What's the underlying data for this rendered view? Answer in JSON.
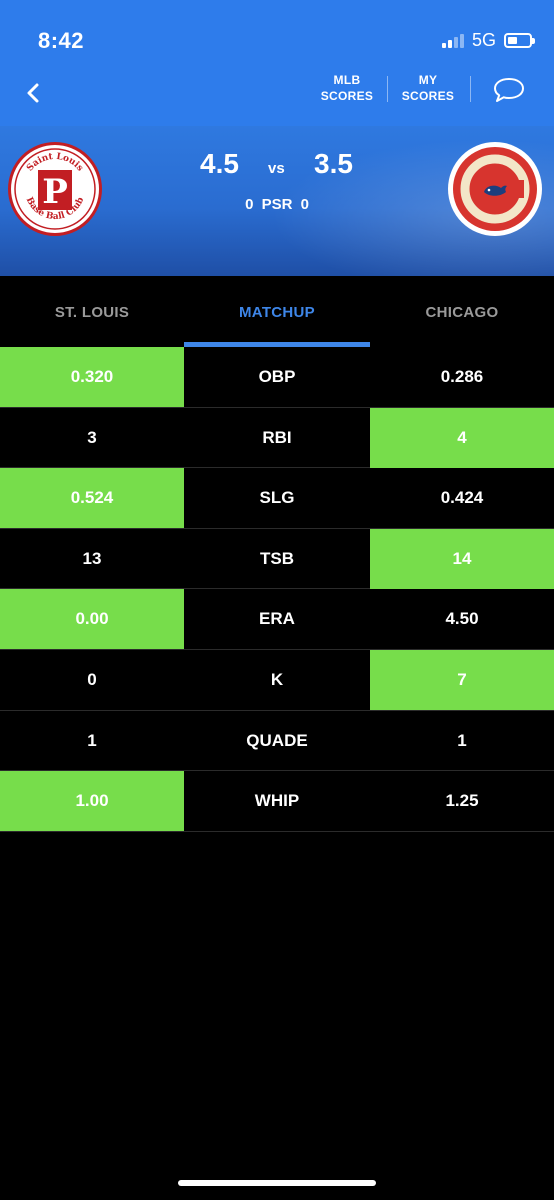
{
  "status_bar": {
    "time": "8:42",
    "network": "5G"
  },
  "header": {
    "mlb_scores": "MLB\nSCORES",
    "my_scores": "MY\nSCORES"
  },
  "game": {
    "away_team": "ST. LOUIS",
    "home_team": "CHICAGO",
    "away_score": "4.5",
    "home_score": "3.5",
    "vs_label": "vs",
    "psr_text": "0 PSR 0",
    "away_logo_text": "P",
    "away_logo_ring_text": "Saint Louis Base Ball Club",
    "home_logo_text": "C"
  },
  "tabs": [
    {
      "label": "ST. LOUIS",
      "active": false
    },
    {
      "label": "MATCHUP",
      "active": true
    },
    {
      "label": "CHICAGO",
      "active": false
    }
  ],
  "stats": [
    {
      "stat": "OBP",
      "away": "0.320",
      "home": "0.286",
      "winner": "away"
    },
    {
      "stat": "RBI",
      "away": "3",
      "home": "4",
      "winner": "home"
    },
    {
      "stat": "SLG",
      "away": "0.524",
      "home": "0.424",
      "winner": "away"
    },
    {
      "stat": "TSB",
      "away": "13",
      "home": "14",
      "winner": "home"
    },
    {
      "stat": "ERA",
      "away": "0.00",
      "home": "4.50",
      "winner": "away"
    },
    {
      "stat": "K",
      "away": "0",
      "home": "7",
      "winner": "home"
    },
    {
      "stat": "QUADE",
      "away": "1",
      "home": "1",
      "winner": "none"
    },
    {
      "stat": "WHIP",
      "away": "1.00",
      "home": "1.25",
      "winner": "away"
    }
  ],
  "colors": {
    "header_blue": "#2E7CEB",
    "accent_blue": "#3E86E8",
    "win_green": "#77DD4B",
    "cardinals_red": "#C21E23",
    "cubs_red": "#D7342E"
  },
  "icons": [
    "back-chevron-icon",
    "chat-bubble-icon",
    "signal-icon",
    "battery-icon"
  ]
}
